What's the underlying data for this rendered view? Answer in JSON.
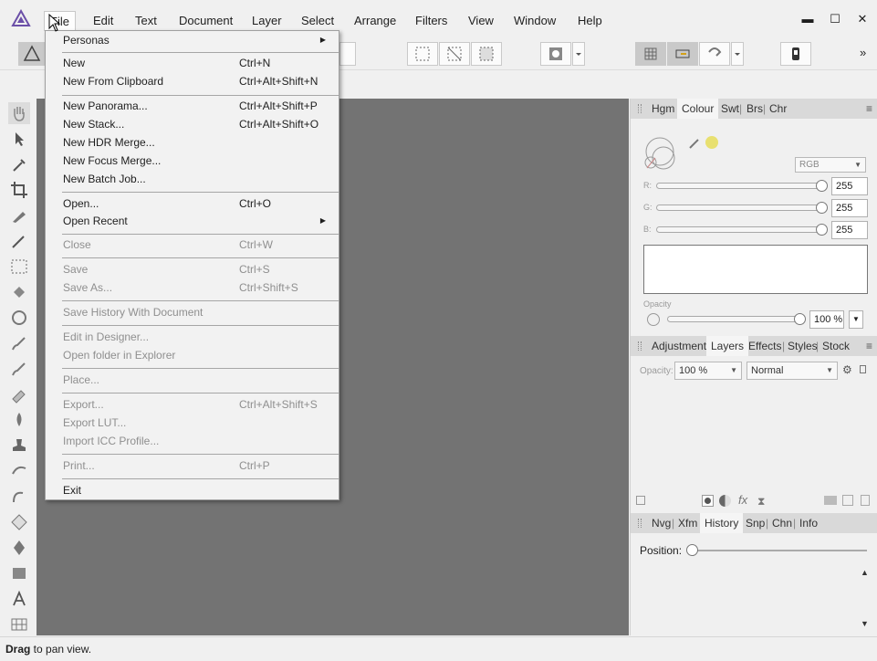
{
  "menubar": {
    "items": [
      "File",
      "Edit",
      "Text",
      "Document",
      "Layer",
      "Select",
      "Arrange",
      "Filters",
      "View",
      "Window",
      "Help"
    ],
    "window_buttons": {
      "minimize": "▬",
      "maximize": "☐",
      "close": "✕"
    }
  },
  "toolbar": {
    "overflow": "»"
  },
  "file_menu": {
    "items": [
      {
        "label": "Personas",
        "shortcut": "",
        "submenu": true,
        "disabled": false
      },
      {
        "label": "New",
        "shortcut": "Ctrl+N",
        "disabled": false
      },
      {
        "label": "New From Clipboard",
        "shortcut": "Ctrl+Alt+Shift+N",
        "disabled": false
      },
      {
        "label": "New Panorama...",
        "shortcut": "Ctrl+Alt+Shift+P",
        "disabled": false
      },
      {
        "label": "New Stack...",
        "shortcut": "Ctrl+Alt+Shift+O",
        "disabled": false
      },
      {
        "label": "New HDR Merge...",
        "shortcut": "",
        "disabled": false
      },
      {
        "label": "New Focus Merge...",
        "shortcut": "",
        "disabled": false
      },
      {
        "label": "New Batch Job...",
        "shortcut": "",
        "disabled": false
      },
      {
        "label": "Open...",
        "shortcut": "Ctrl+O",
        "disabled": false
      },
      {
        "label": "Open Recent",
        "shortcut": "",
        "submenu": true,
        "disabled": false
      },
      {
        "label": "Close",
        "shortcut": "Ctrl+W",
        "disabled": true
      },
      {
        "label": "Save",
        "shortcut": "Ctrl+S",
        "disabled": true
      },
      {
        "label": "Save As...",
        "shortcut": "Ctrl+Shift+S",
        "disabled": true
      },
      {
        "label": "Save History With Document",
        "shortcut": "",
        "disabled": true
      },
      {
        "label": "Edit in Designer...",
        "shortcut": "",
        "disabled": true
      },
      {
        "label": "Open folder in Explorer",
        "shortcut": "",
        "disabled": true
      },
      {
        "label": "Place...",
        "shortcut": "",
        "disabled": true
      },
      {
        "label": "Export...",
        "shortcut": "Ctrl+Alt+Shift+S",
        "disabled": true
      },
      {
        "label": "Export LUT...",
        "shortcut": "",
        "disabled": true
      },
      {
        "label": "Import ICC Profile...",
        "shortcut": "",
        "disabled": true
      },
      {
        "label": "Print...",
        "shortcut": "Ctrl+P",
        "disabled": true
      },
      {
        "label": "Exit",
        "shortcut": "",
        "disabled": false
      }
    ]
  },
  "colour_panel": {
    "tabs": [
      "Hgm",
      "Colour",
      "Swt",
      "Brs",
      "Chr"
    ],
    "active_tab": "Colour",
    "mode": "RGB",
    "channels": [
      {
        "label": "R:",
        "value": "255"
      },
      {
        "label": "G:",
        "value": "255"
      },
      {
        "label": "B:",
        "value": "255"
      }
    ],
    "opacity_label": "Opacity",
    "opacity_value": "100 %"
  },
  "layers_panel": {
    "tabs": [
      "Adjustment",
      "Layers",
      "Effects",
      "Styles",
      "Stock"
    ],
    "active_tab": "Layers",
    "opacity_label": "Opacity:",
    "opacity_value": "100 %",
    "blend_mode": "Normal"
  },
  "history_panel": {
    "tabs": [
      "Nvg",
      "Xfm",
      "History",
      "Snp",
      "Chn",
      "Info"
    ],
    "active_tab": "History",
    "position_label": "Position:"
  },
  "status": {
    "bold": "Drag",
    "text": " to pan view."
  },
  "colors": {
    "canvas": "#737373",
    "panel_bg": "#f0f0f0",
    "tabbar": "#d9d9d9"
  }
}
